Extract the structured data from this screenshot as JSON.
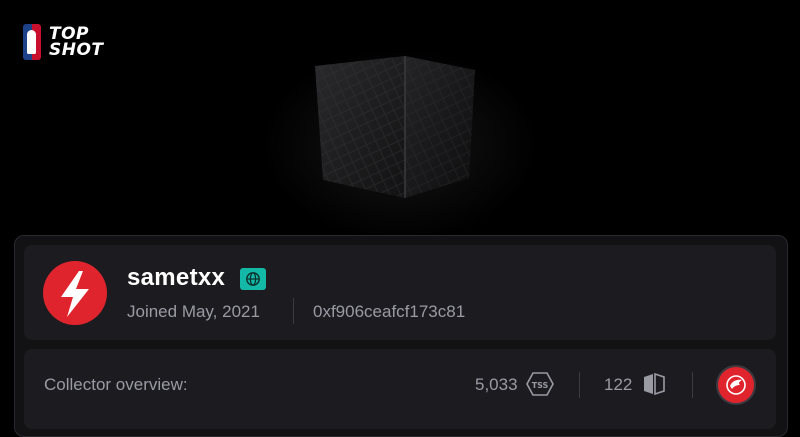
{
  "brand": {
    "logo_line1": "TOP",
    "logo_line2": "SHOT"
  },
  "profile": {
    "username": "sametxx",
    "joined": "Joined May, 2021",
    "address": "0xf906ceafcf173c81",
    "badge_icon": "globe-icon",
    "avatar_icon": "lightning-bolt-icon",
    "avatar_color": "#e0242d"
  },
  "overview": {
    "label": "Collector overview:",
    "score": "5,033",
    "score_icon": "tss-icon",
    "count": "122",
    "count_icon": "collection-icon",
    "team_icon": "hawks-logo-icon",
    "team_color": "#e0242d"
  },
  "colors": {
    "background": "#000000",
    "card": "#1c1c20",
    "muted_text": "#9a9aa3",
    "badge_teal": "#14b8a6"
  }
}
